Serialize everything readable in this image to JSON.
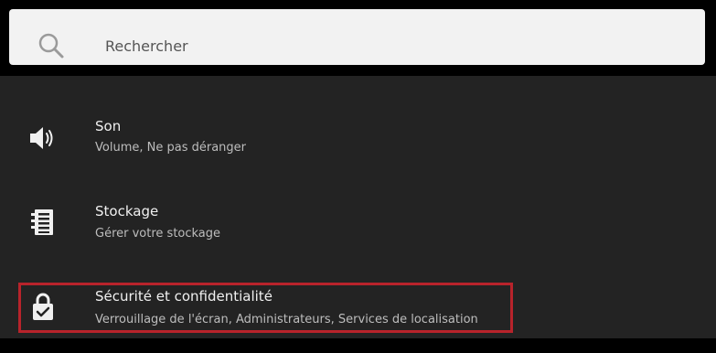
{
  "search": {
    "placeholder": "Rechercher",
    "icon": "search-icon"
  },
  "settings": {
    "items": [
      {
        "icon": "speaker-icon",
        "title": "Son",
        "subtitle": "Volume, Ne pas déranger"
      },
      {
        "icon": "storage-icon",
        "title": "Stockage",
        "subtitle": "Gérer votre stockage"
      },
      {
        "icon": "lock-icon",
        "title": "Sécurité et confidentialité",
        "subtitle": "Verrouillage de l'écran, Administrateurs, Services de localisation",
        "highlighted": true
      }
    ]
  },
  "colors": {
    "background": "#232323",
    "topbar": "#000000",
    "search_field": "#f2f2f2",
    "highlight_border": "#b8232b",
    "title_text": "#f0f0f0",
    "subtitle_text": "#bdbdbd"
  }
}
